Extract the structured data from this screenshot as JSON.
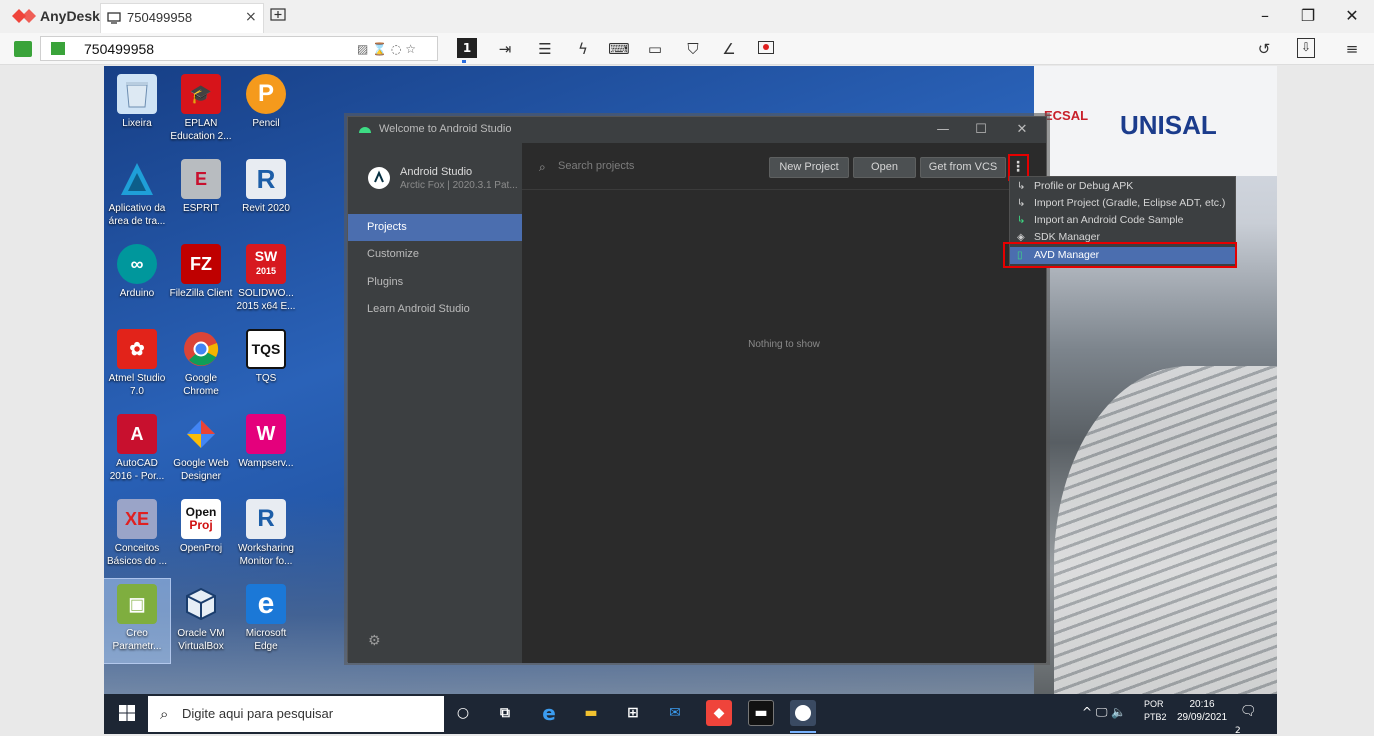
{
  "anydesk": {
    "app_name": "AnyDesk",
    "tab_label": "750499958",
    "tab_close": "×",
    "address": "750499958",
    "session_number": "1",
    "window_controls": {
      "minimize": "–",
      "maximize": "❐",
      "close": "✕"
    },
    "colors": {
      "brand": "#ef443b",
      "ok": "#3aa33a"
    },
    "toolbar_icons": [
      "file-transfer-icon",
      "chat-icon",
      "actions-icon",
      "keyboard-icon",
      "display-icon",
      "permissions-icon",
      "whiteboard-icon",
      "record-icon"
    ]
  },
  "desktop": {
    "icons": [
      {
        "label": "Lixeira",
        "icon": "recycle-bin-icon"
      },
      {
        "label": "EPLAN Education 2...",
        "icon": "eplan-icon"
      },
      {
        "label": "Pencil",
        "icon": "pencil-icon"
      },
      {
        "label": "Aplicativo da área de tra...",
        "icon": "autodesk-app-icon"
      },
      {
        "label": "ESPRIT",
        "icon": "esprit-icon"
      },
      {
        "label": "Revit 2020",
        "icon": "revit-icon"
      },
      {
        "label": "Arduino",
        "icon": "arduino-icon"
      },
      {
        "label": "FileZilla Client",
        "icon": "filezilla-icon"
      },
      {
        "label": "SOLIDWO... 2015 x64 E...",
        "icon": "solidworks-icon"
      },
      {
        "label": "Atmel Studio 7.0",
        "icon": "atmel-icon"
      },
      {
        "label": "Google Chrome",
        "icon": "chrome-icon"
      },
      {
        "label": "TQS",
        "icon": "tqs-icon"
      },
      {
        "label": "AutoCAD 2016 - Por...",
        "icon": "autocad-icon"
      },
      {
        "label": "Google Web Designer",
        "icon": "google-web-designer-icon"
      },
      {
        "label": "Wampserv...",
        "icon": "wampserver-icon"
      },
      {
        "label": "Conceitos Básicos do ...",
        "icon": "database-icon"
      },
      {
        "label": "OpenProj",
        "icon": "openproj-icon"
      },
      {
        "label": "Worksharing Monitor fo...",
        "icon": "worksharing-icon"
      },
      {
        "label": "Creo Parametr...",
        "icon": "creo-icon"
      },
      {
        "label": "Oracle VM VirtualBox",
        "icon": "virtualbox-icon"
      },
      {
        "label": "Microsoft Edge",
        "icon": "edge-icon"
      }
    ],
    "icon_texts": {
      "fz": "FZ",
      "sw": "SW",
      "swy": "2015",
      "r": "R",
      "tqs": "TQS",
      "open": "Open",
      "proj": "Proj",
      "e": "e",
      "xe": "XE",
      "p": "P"
    },
    "logos": {
      "unisal": "UNISAL",
      "ecsal": "ECSAL"
    }
  },
  "taskbar": {
    "search_placeholder": "Digite aqui para pesquisar",
    "language": "POR",
    "layout": "PTB2",
    "time": "20:16",
    "date": "29/09/2021",
    "notifications": "2",
    "tray_icons": "^ 🖵 🔈"
  },
  "android_studio": {
    "window_title": "Welcome to Android Studio",
    "app_name": "Android Studio",
    "app_version": "Arctic Fox | 2020.3.1 Pat...",
    "nav": [
      "Projects",
      "Customize",
      "Plugins",
      "Learn Android Studio"
    ],
    "search_placeholder": "Search projects",
    "buttons": {
      "new_project": "New Project",
      "open": "Open",
      "get_from_vcs": "Get from VCS"
    },
    "more": "⋮",
    "empty_text": "Nothing to show",
    "menu": [
      {
        "label": "Profile or Debug APK",
        "icon": "profile-apk-icon"
      },
      {
        "label": "Import Project (Gradle, Eclipse ADT, etc.)",
        "icon": "import-project-icon"
      },
      {
        "label": "Import an Android Code Sample",
        "icon": "import-sample-icon"
      },
      {
        "label": "SDK Manager",
        "icon": "sdk-manager-icon"
      },
      {
        "label": "AVD Manager",
        "icon": "avd-manager-icon",
        "highlighted": true
      }
    ],
    "colors": {
      "accent": "#4b6eaf",
      "highlight_box": "#e60000"
    }
  }
}
